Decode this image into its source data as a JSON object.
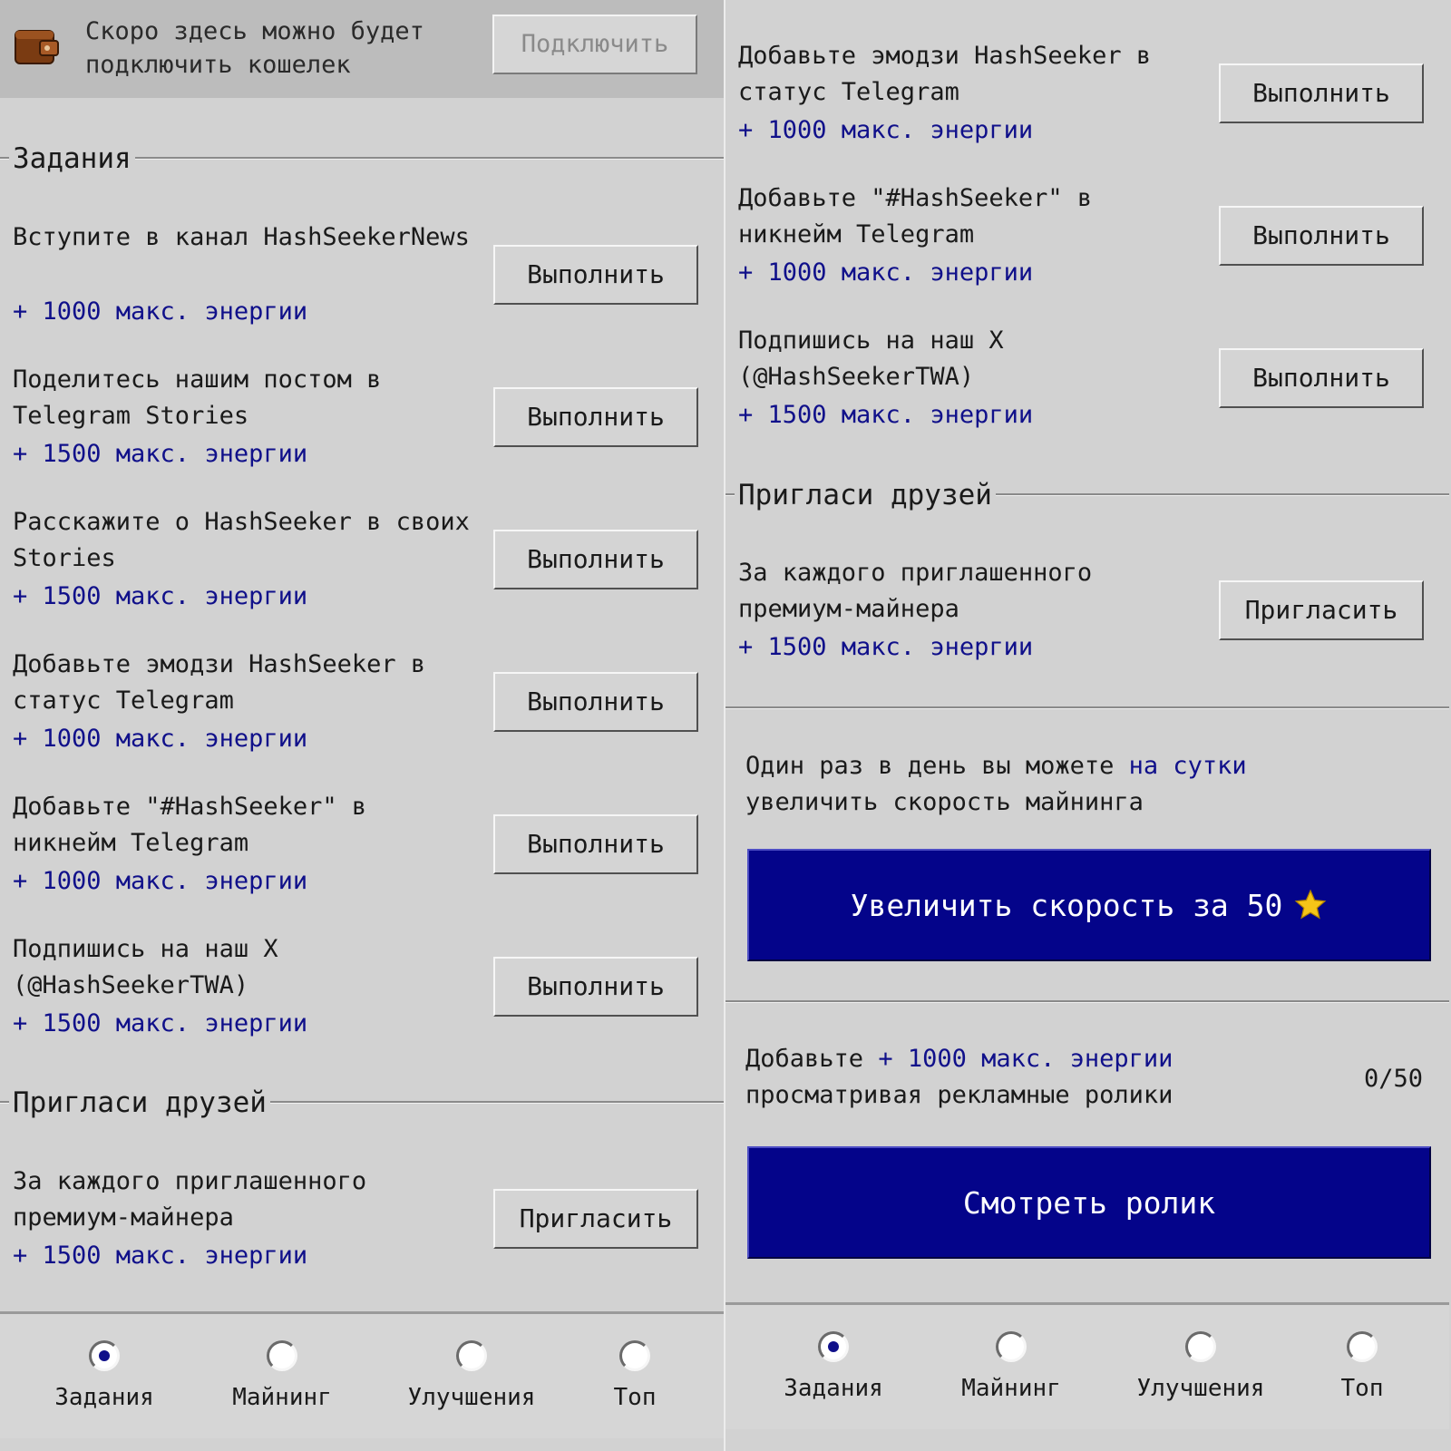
{
  "wallet": {
    "text": "Скоро здесь можно будет подключить кошелек",
    "button": "Подключить"
  },
  "sections": {
    "tasks_title": "Задания",
    "invite_title": "Пригласи друзей"
  },
  "tasks": [
    {
      "title": "Вступите в канал HashSeekerNews",
      "reward": "+ 1000 макс. энергии",
      "button": "Выполнить"
    },
    {
      "title": "Поделитесь нашим постом в Telegram Stories",
      "reward": "+ 1500 макс. энергии",
      "button": "Выполнить"
    },
    {
      "title": "Расскажите о HashSeeker в своих Stories",
      "reward": "+ 1500 макс. энергии",
      "button": "Выполнить"
    },
    {
      "title": "Добавьте эмодзи HashSeeker в статус Telegram",
      "reward": "+ 1000 макс. энергии",
      "button": "Выполнить"
    },
    {
      "title": "Добавьте \"#HashSeeker\" в никнейм Telegram",
      "reward": "+ 1000 макс. энергии",
      "button": "Выполнить"
    },
    {
      "title": "Подпишись на наш X (@HashSeekerTWA)",
      "reward": "+ 1500 макс. энергии",
      "button": "Выполнить"
    }
  ],
  "invite": {
    "title": "За каждого приглашенного премиум-майнера",
    "reward": "+ 1500 макс. энергии",
    "button": "Пригласить"
  },
  "daily_boost": {
    "text_before": "Один раз в день вы можете ",
    "highlight": "на сутки",
    "text_after": " увеличить скорость майнинга",
    "button": "Увеличить скорость за 50",
    "button_icon": "star-icon"
  },
  "ads": {
    "text_before": "Добавьте ",
    "highlight": "+ 1000 макс. энергии",
    "text_after": " просматривая рекламные ролики",
    "counter": "0/50",
    "button": "Смотреть ролик"
  },
  "nav": {
    "items": [
      {
        "label": "Задания",
        "selected": true
      },
      {
        "label": "Майнинг",
        "selected": false
      },
      {
        "label": "Улучшения",
        "selected": false
      },
      {
        "label": "Топ",
        "selected": false
      }
    ]
  },
  "colors": {
    "background": "#d2d2d2",
    "accent": "#04048a",
    "reward_text": "#10108a",
    "star": "#f5c518"
  }
}
